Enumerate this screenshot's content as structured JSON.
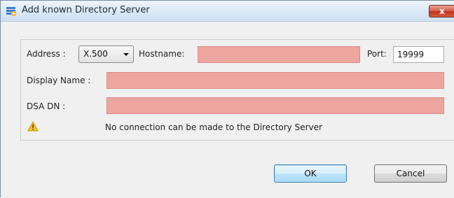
{
  "window": {
    "title": "Add known Directory Server",
    "close_glyph": "x"
  },
  "form": {
    "address_label": "Address :",
    "address_type": "X.500",
    "hostname_label": "Hostname:",
    "hostname_value": "",
    "port_label": "Port:",
    "port_value": "19999",
    "display_name_label": "Display Name :",
    "display_name_value": "",
    "dsa_dn_label": "DSA DN :",
    "dsa_dn_value": ""
  },
  "status": {
    "icon": "warning-icon",
    "message": "No connection can be made to the Directory Server"
  },
  "buttons": {
    "ok_label": "OK",
    "cancel_label": "Cancel"
  },
  "colors": {
    "invalid_field": "#eca59f",
    "default_button": "#3c7fb1"
  }
}
